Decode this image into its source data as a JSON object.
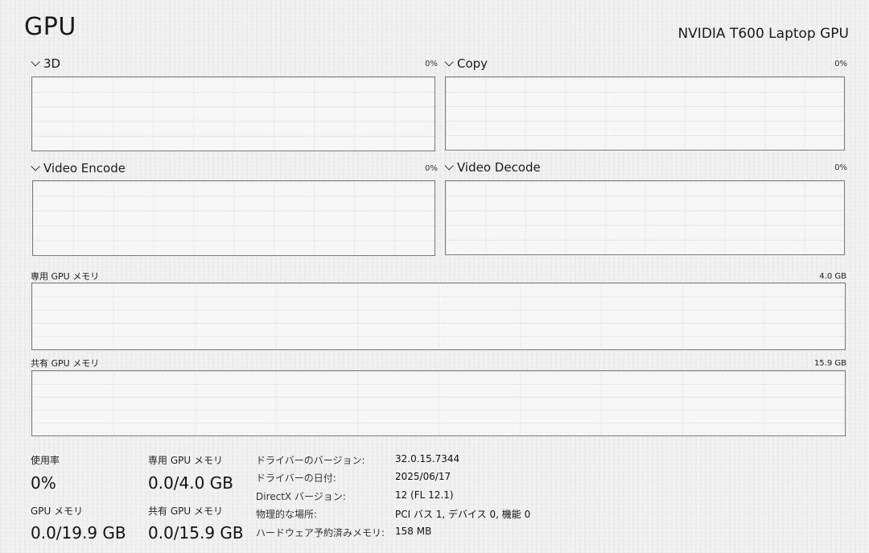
{
  "header": {
    "title": "GPU",
    "gpu_name": "NVIDIA T600 Laptop GPU"
  },
  "engines": [
    {
      "label": "3D",
      "percent": "0%"
    },
    {
      "label": "Copy",
      "percent": "0%"
    },
    {
      "label": "Video Encode",
      "percent": "0%"
    },
    {
      "label": "Video Decode",
      "percent": "0%"
    }
  ],
  "memory_graphs": {
    "dedicated": {
      "label": "専用 GPU メモリ",
      "max": "4.0 GB"
    },
    "shared": {
      "label": "共有 GPU メモリ",
      "max": "15.9 GB"
    }
  },
  "stats": {
    "utilization": {
      "label": "使用率",
      "value": "0%"
    },
    "dedicated_mem": {
      "label": "専用 GPU メモリ",
      "value": "0.0/4.0 GB"
    },
    "gpu_mem": {
      "label": "GPU メモリ",
      "value": "0.0/19.9 GB"
    },
    "shared_mem": {
      "label": "共有 GPU メモリ",
      "value": "0.0/15.9 GB"
    }
  },
  "properties": [
    {
      "label": "ドライバーのバージョン:",
      "value": "32.0.15.7344"
    },
    {
      "label": "ドライバーの日付:",
      "value": "2025/06/17"
    },
    {
      "label": "DirectX バージョン:",
      "value": "12 (FL 12.1)"
    },
    {
      "label": "物理的な場所:",
      "value": "PCI バス 1, デバイス 0, 機能 0"
    },
    {
      "label": "ハードウェア予約済みメモリ:",
      "value": "158 MB"
    }
  ]
}
